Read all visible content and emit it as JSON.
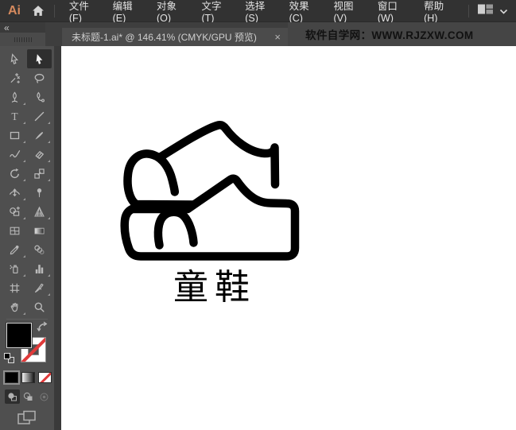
{
  "app": {
    "logo_text": "Ai",
    "menu_items": [
      "文件(F)",
      "编辑(E)",
      "对象(O)",
      "文字(T)",
      "选择(S)",
      "效果(C)",
      "视图(V)",
      "窗口(W)",
      "帮助(H)"
    ]
  },
  "tab_bar": {
    "collapse_glyph": "«",
    "document_tab": {
      "title": "未标题-1.ai* @ 146.41% (CMYK/GPU 预览)",
      "close_glyph": "×"
    },
    "watermark": "软件自学网：WWW.RJZXW.COM"
  },
  "tools_panel": {
    "tools": [
      {
        "name": "direct-selection-tool",
        "active": false,
        "flyout": false
      },
      {
        "name": "selection-tool",
        "active": true,
        "flyout": false
      },
      {
        "name": "magic-wand-tool",
        "active": false,
        "flyout": false
      },
      {
        "name": "lasso-tool",
        "active": false,
        "flyout": false
      },
      {
        "name": "pen-tool",
        "active": false,
        "flyout": true
      },
      {
        "name": "curvature-tool",
        "active": false,
        "flyout": false
      },
      {
        "name": "type-tool",
        "active": false,
        "flyout": true
      },
      {
        "name": "line-segment-tool",
        "active": false,
        "flyout": true
      },
      {
        "name": "rectangle-tool",
        "active": false,
        "flyout": true
      },
      {
        "name": "paintbrush-tool",
        "active": false,
        "flyout": true
      },
      {
        "name": "shaper-tool",
        "active": false,
        "flyout": true
      },
      {
        "name": "eraser-tool",
        "active": false,
        "flyout": true
      },
      {
        "name": "rotate-tool",
        "active": false,
        "flyout": true
      },
      {
        "name": "scale-tool",
        "active": false,
        "flyout": true
      },
      {
        "name": "width-tool",
        "active": false,
        "flyout": true
      },
      {
        "name": "puppet-warp-tool",
        "active": false,
        "flyout": false
      },
      {
        "name": "shape-builder-tool",
        "active": false,
        "flyout": true
      },
      {
        "name": "perspective-grid-tool",
        "active": false,
        "flyout": true
      },
      {
        "name": "mesh-tool",
        "active": false,
        "flyout": false
      },
      {
        "name": "gradient-tool",
        "active": false,
        "flyout": false
      },
      {
        "name": "eyedropper-tool",
        "active": false,
        "flyout": true
      },
      {
        "name": "blend-tool",
        "active": false,
        "flyout": false
      },
      {
        "name": "symbol-sprayer-tool",
        "active": false,
        "flyout": true
      },
      {
        "name": "column-graph-tool",
        "active": false,
        "flyout": true
      },
      {
        "name": "artboard-tool",
        "active": false,
        "flyout": false
      },
      {
        "name": "slice-tool",
        "active": false,
        "flyout": true
      },
      {
        "name": "hand-tool",
        "active": false,
        "flyout": true
      },
      {
        "name": "zoom-tool",
        "active": false,
        "flyout": false
      }
    ],
    "fill_color": "#000000",
    "stroke_style": "none",
    "none_indicator_color": "#e03a3a"
  },
  "canvas": {
    "artwork": "children-shoes-line-drawing",
    "artwork_stroke_color": "#000000",
    "background_color": "#ffffff",
    "label": "童鞋"
  }
}
